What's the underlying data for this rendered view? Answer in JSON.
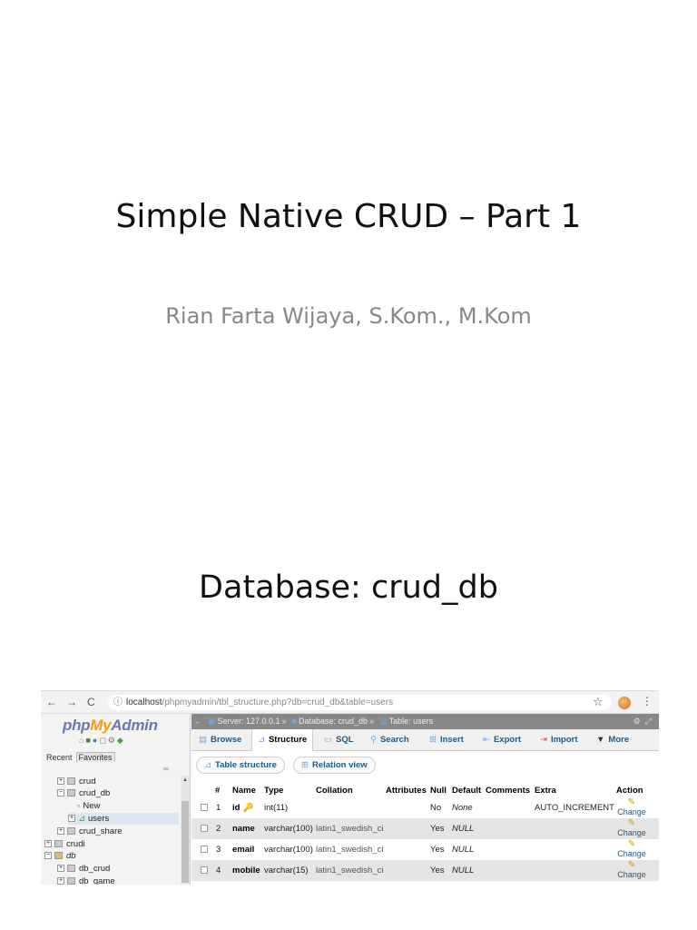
{
  "slide": {
    "title": "Simple Native CRUD – Part 1",
    "subtitle": "Rian Farta Wijaya, S.Kom., M.Kom",
    "heading": "Database: crud_db"
  },
  "browser": {
    "back": "←",
    "forward": "→",
    "reload": "C",
    "info": "ⓘ",
    "url_host": "localhost",
    "url_path": "/phpmyadmin/tbl_structure.php?db=crud_db&table=users",
    "star": "☆",
    "menu": "⋮"
  },
  "nav": {
    "logo_php": "php",
    "logo_my": "My",
    "logo_admin": "Admin",
    "tab_recent": "Recent",
    "tab_favorites": "Favorites",
    "link_icon": "∞",
    "tree": [
      {
        "label": "crud",
        "exp": "+"
      },
      {
        "label": "crud_db",
        "exp": "−"
      },
      {
        "label": "New"
      },
      {
        "label": "users",
        "exp": "+"
      },
      {
        "label": "crud_share",
        "exp": "+"
      },
      {
        "label": "crudi",
        "exp": "+"
      },
      {
        "label": "db",
        "exp": "−"
      },
      {
        "label": "db_crud",
        "exp": "+"
      },
      {
        "label": "db_game",
        "exp": "+"
      }
    ]
  },
  "main": {
    "collapse": "←",
    "breadcrumb": {
      "server": "Server: 127.0.0.1",
      "database": "Database: crud_db",
      "table": "Table: users",
      "sep": "»",
      "gear": "⚙",
      "close": "⤢"
    },
    "tabs": [
      "Browse",
      "Structure",
      "SQL",
      "Search",
      "Insert",
      "Export",
      "Import",
      "More"
    ],
    "more_arrow": "▼",
    "subtabs": [
      "Table structure",
      "Relation view"
    ],
    "columns": [
      "#",
      "Name",
      "Type",
      "Collation",
      "Attributes",
      "Null",
      "Default",
      "Comments",
      "Extra",
      "Action"
    ],
    "rows": [
      {
        "num": "1",
        "name": "id",
        "type": "int(11)",
        "collation": "",
        "null": "No",
        "default": "None",
        "extra": "AUTO_INCREMENT",
        "action": "Change"
      },
      {
        "num": "2",
        "name": "name",
        "type": "varchar(100)",
        "collation": "latin1_swedish_ci",
        "null": "Yes",
        "default": "NULL",
        "extra": "",
        "action": "Change"
      },
      {
        "num": "3",
        "name": "email",
        "type": "varchar(100)",
        "collation": "latin1_swedish_ci",
        "null": "Yes",
        "default": "NULL",
        "extra": "",
        "action": "Change"
      },
      {
        "num": "4",
        "name": "mobile",
        "type": "varchar(15)",
        "collation": "latin1_swedish_ci",
        "null": "Yes",
        "default": "NULL",
        "extra": "",
        "action": "Change"
      }
    ]
  }
}
